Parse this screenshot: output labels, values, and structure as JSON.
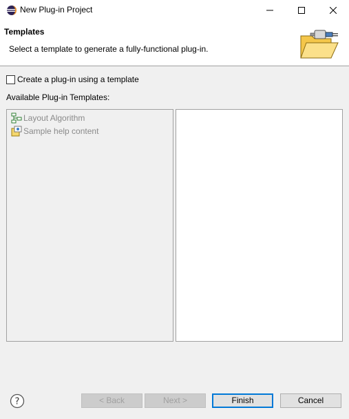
{
  "window": {
    "title": "New Plug-in Project",
    "icons": {
      "app": "eclipse-icon",
      "minimize": "minimize-icon",
      "maximize": "maximize-icon",
      "close": "close-icon"
    }
  },
  "header": {
    "title": "Templates",
    "description": "Select a template to generate a fully-functional plug-in.",
    "image": "plugin-folder-wizard-icon"
  },
  "use_template": {
    "label": "Create a plug-in using a template",
    "checked": false
  },
  "templates": {
    "label": "Available Plug-in Templates:",
    "items": [
      {
        "label": "Layout Algorithm",
        "icon": "layout-algorithm-icon",
        "enabled": false
      },
      {
        "label": "Sample help content",
        "icon": "help-content-icon",
        "enabled": false
      }
    ]
  },
  "buttons": {
    "help_icon": "help-icon",
    "back": "< Back",
    "next": "Next >",
    "finish": "Finish",
    "cancel": "Cancel"
  },
  "colors": {
    "default_button_border": "#0078d7",
    "disabled_text": "#8a8a8a"
  }
}
